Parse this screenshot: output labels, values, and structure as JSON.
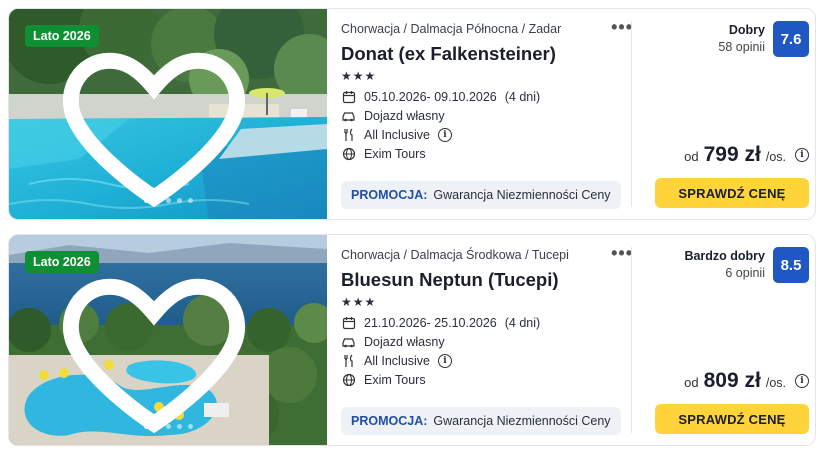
{
  "offers": [
    {
      "badge": "Lato 2026",
      "breadcrumb": "Chorwacja / Dalmacja Północna / Zadar",
      "name": "Donat (ex Falkensteiner)",
      "stars": "★★★",
      "dates": "05.10.2026- 09.10.2026",
      "duration": "(4 dni)",
      "transport": "Dojazd własny",
      "board": "All Inclusive",
      "operator": "Exim Tours",
      "promo_label": "PROMOCJA:",
      "promo_text": "Gwarancja Niezmienności Ceny",
      "rating_label": "Dobry",
      "rating_count": "58 opinii",
      "score": "7.6",
      "price_prefix": "od",
      "price": "799 zł",
      "price_suffix": "/os.",
      "cta": "SPRAWDŹ CENĘ"
    },
    {
      "badge": "Lato 2026",
      "breadcrumb": "Chorwacja / Dalmacja Środkowa / Tucepi",
      "name": "Bluesun Neptun (Tucepi)",
      "stars": "★★★",
      "dates": "21.10.2026- 25.10.2026",
      "duration": "(4 dni)",
      "transport": "Dojazd własny",
      "board": "All Inclusive",
      "operator": "Exim Tours",
      "promo_label": "PROMOCJA:",
      "promo_text": "Gwarancja Niezmienności Ceny",
      "rating_label": "Bardzo dobry",
      "rating_count": "6 opinii",
      "score": "8.5",
      "price_prefix": "od",
      "price": "809 zł",
      "price_suffix": "/os.",
      "cta": "SPRAWDŹ CENĘ"
    }
  ],
  "colors": {
    "badge": "#0f8f33",
    "score": "#1f57c3",
    "cta": "#ffd43b",
    "promo": "#1f4fa8"
  },
  "icons": [
    "heart-icon",
    "calendar-icon",
    "car-icon",
    "cutlery-icon",
    "info-icon",
    "globe-icon",
    "more-icon"
  ]
}
